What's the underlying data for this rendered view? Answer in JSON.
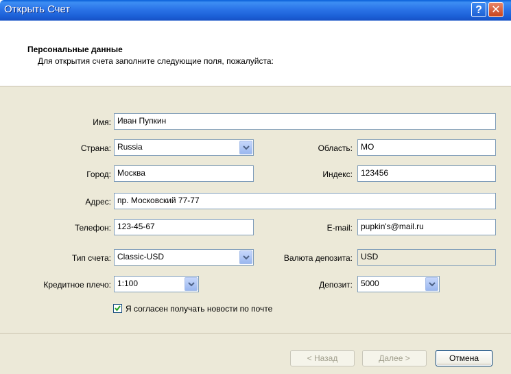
{
  "window": {
    "title": "Открыть Счет",
    "help_label": "?",
    "close_label": "✕"
  },
  "header": {
    "title": "Персональные данные",
    "subtitle": "Для открытия счета заполните следующие поля, пожалуйста:"
  },
  "form": {
    "name": {
      "label": "Имя:",
      "value": "Иван Пупкин"
    },
    "country": {
      "label": "Страна:",
      "value": "Russia"
    },
    "region": {
      "label": "Область:",
      "value": "МО"
    },
    "city": {
      "label": "Город:",
      "value": "Москва"
    },
    "zip": {
      "label": "Индекс:",
      "value": "123456"
    },
    "address": {
      "label": "Адрес:",
      "value": "пр. Московский 77-77"
    },
    "phone": {
      "label": "Телефон:",
      "value": "123-45-67"
    },
    "email": {
      "label": "E-mail:",
      "value": "pupkin's@mail.ru"
    },
    "account_type": {
      "label": "Тип счета:",
      "value": "Classic-USD"
    },
    "deposit_currency": {
      "label": "Валюта депозита:",
      "value": "USD"
    },
    "leverage": {
      "label": "Кредитное плечо:",
      "value": "1:100"
    },
    "deposit": {
      "label": "Депозит:",
      "value": "5000"
    },
    "newsletter": {
      "label": "Я согласен получать новости по почте",
      "checked": true
    }
  },
  "footer": {
    "back_label": "< Назад",
    "next_label": "Далее >",
    "cancel_label": "Отмена"
  }
}
